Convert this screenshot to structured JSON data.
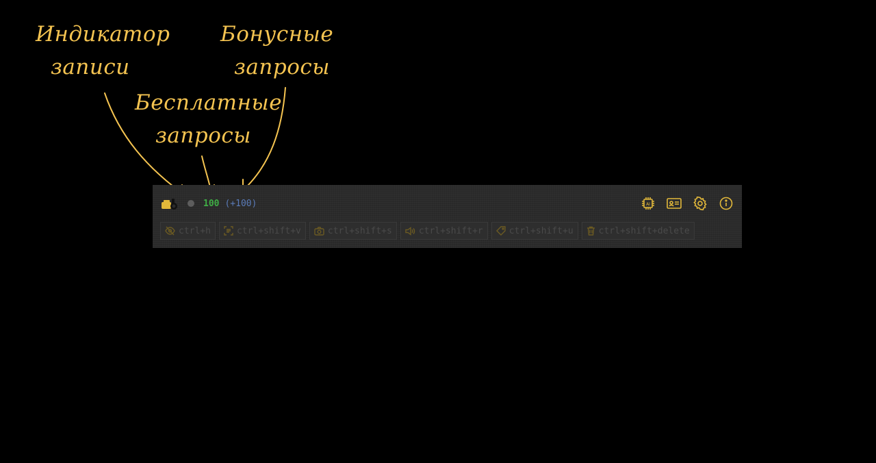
{
  "annotations": {
    "recording_indicator": [
      "Индикатор",
      "записи"
    ],
    "bonus_requests": [
      "Бонусные",
      "запросы"
    ],
    "free_requests": [
      "Бесплатные",
      "запросы"
    ]
  },
  "toolbar": {
    "free_requests": "100",
    "bonus_requests": "(+100)",
    "icons": [
      "ai-chip-icon",
      "id-card-icon",
      "gear-icon",
      "info-icon"
    ]
  },
  "hotkeys": [
    {
      "icon": "eye-off-icon",
      "label": "ctrl+h"
    },
    {
      "icon": "scan-text-icon",
      "label": "ctrl+shift+v"
    },
    {
      "icon": "camera-icon",
      "label": "ctrl+shift+s"
    },
    {
      "icon": "speaker-icon",
      "label": "ctrl+shift+r"
    },
    {
      "icon": "tag-icon",
      "label": "ctrl+shift+u"
    },
    {
      "icon": "trash-icon",
      "label": "ctrl+shift+delete"
    }
  ],
  "colors": {
    "annotation": "#f5c451",
    "free": "#3fae45",
    "bonus": "#5a7bb8",
    "icon_accent": "#e3b93a",
    "panel": "#2b2b2b"
  }
}
